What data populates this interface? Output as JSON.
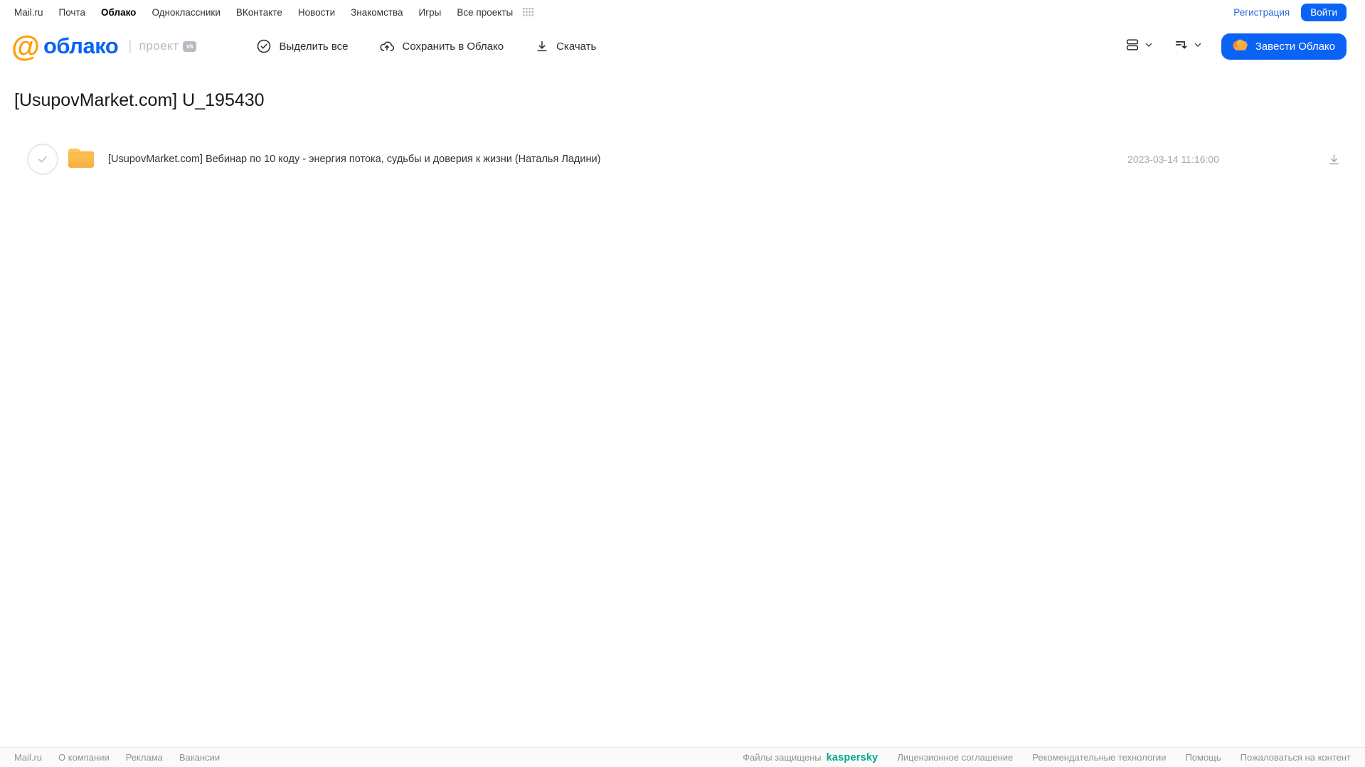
{
  "topbar": {
    "links": [
      {
        "label": "Mail.ru",
        "active": false
      },
      {
        "label": "Почта",
        "active": false
      },
      {
        "label": "Облако",
        "active": true
      },
      {
        "label": "Одноклассники",
        "active": false
      },
      {
        "label": "ВКонтакте",
        "active": false
      },
      {
        "label": "Новости",
        "active": false
      },
      {
        "label": "Знакомства",
        "active": false
      },
      {
        "label": "Игры",
        "active": false
      },
      {
        "label": "Все проекты",
        "active": false
      }
    ],
    "registration_label": "Регистрация",
    "login_label": "Войти"
  },
  "header": {
    "logo_at": "@",
    "logo_word": "облако",
    "project_label": "проект",
    "vk_badge": "vk",
    "toolbar": {
      "select_all_label": "Выделить все",
      "save_to_cloud_label": "Сохранить в Облако",
      "download_label": "Скачать"
    },
    "create_cloud_label": "Завести Облако"
  },
  "page": {
    "title": "[UsupovMarket.com] U_195430"
  },
  "files": [
    {
      "type": "folder",
      "name": "[UsupovMarket.com] Вебинар по 10 коду - энергия потока, судьбы и доверия к жизни (Наталья Ладини)",
      "date": "2023-03-14 11:16:00"
    }
  ],
  "footer": {
    "left_links": [
      "Mail.ru",
      "О компании",
      "Реклама",
      "Вакансии"
    ],
    "protected_label": "Файлы защищены",
    "kaspersky_label": "kaspersky",
    "right_links": [
      "Лицензионное соглашение",
      "Рекомендательные технологии",
      "Помощь",
      "Пожаловаться на контент"
    ]
  },
  "colors": {
    "accent_blue": "#0b63f6",
    "logo_orange": "#ff9e00",
    "kaspersky_green": "#00a88e",
    "folder_yellow": "#fbb843",
    "muted_gray": "#a5a7aa"
  }
}
